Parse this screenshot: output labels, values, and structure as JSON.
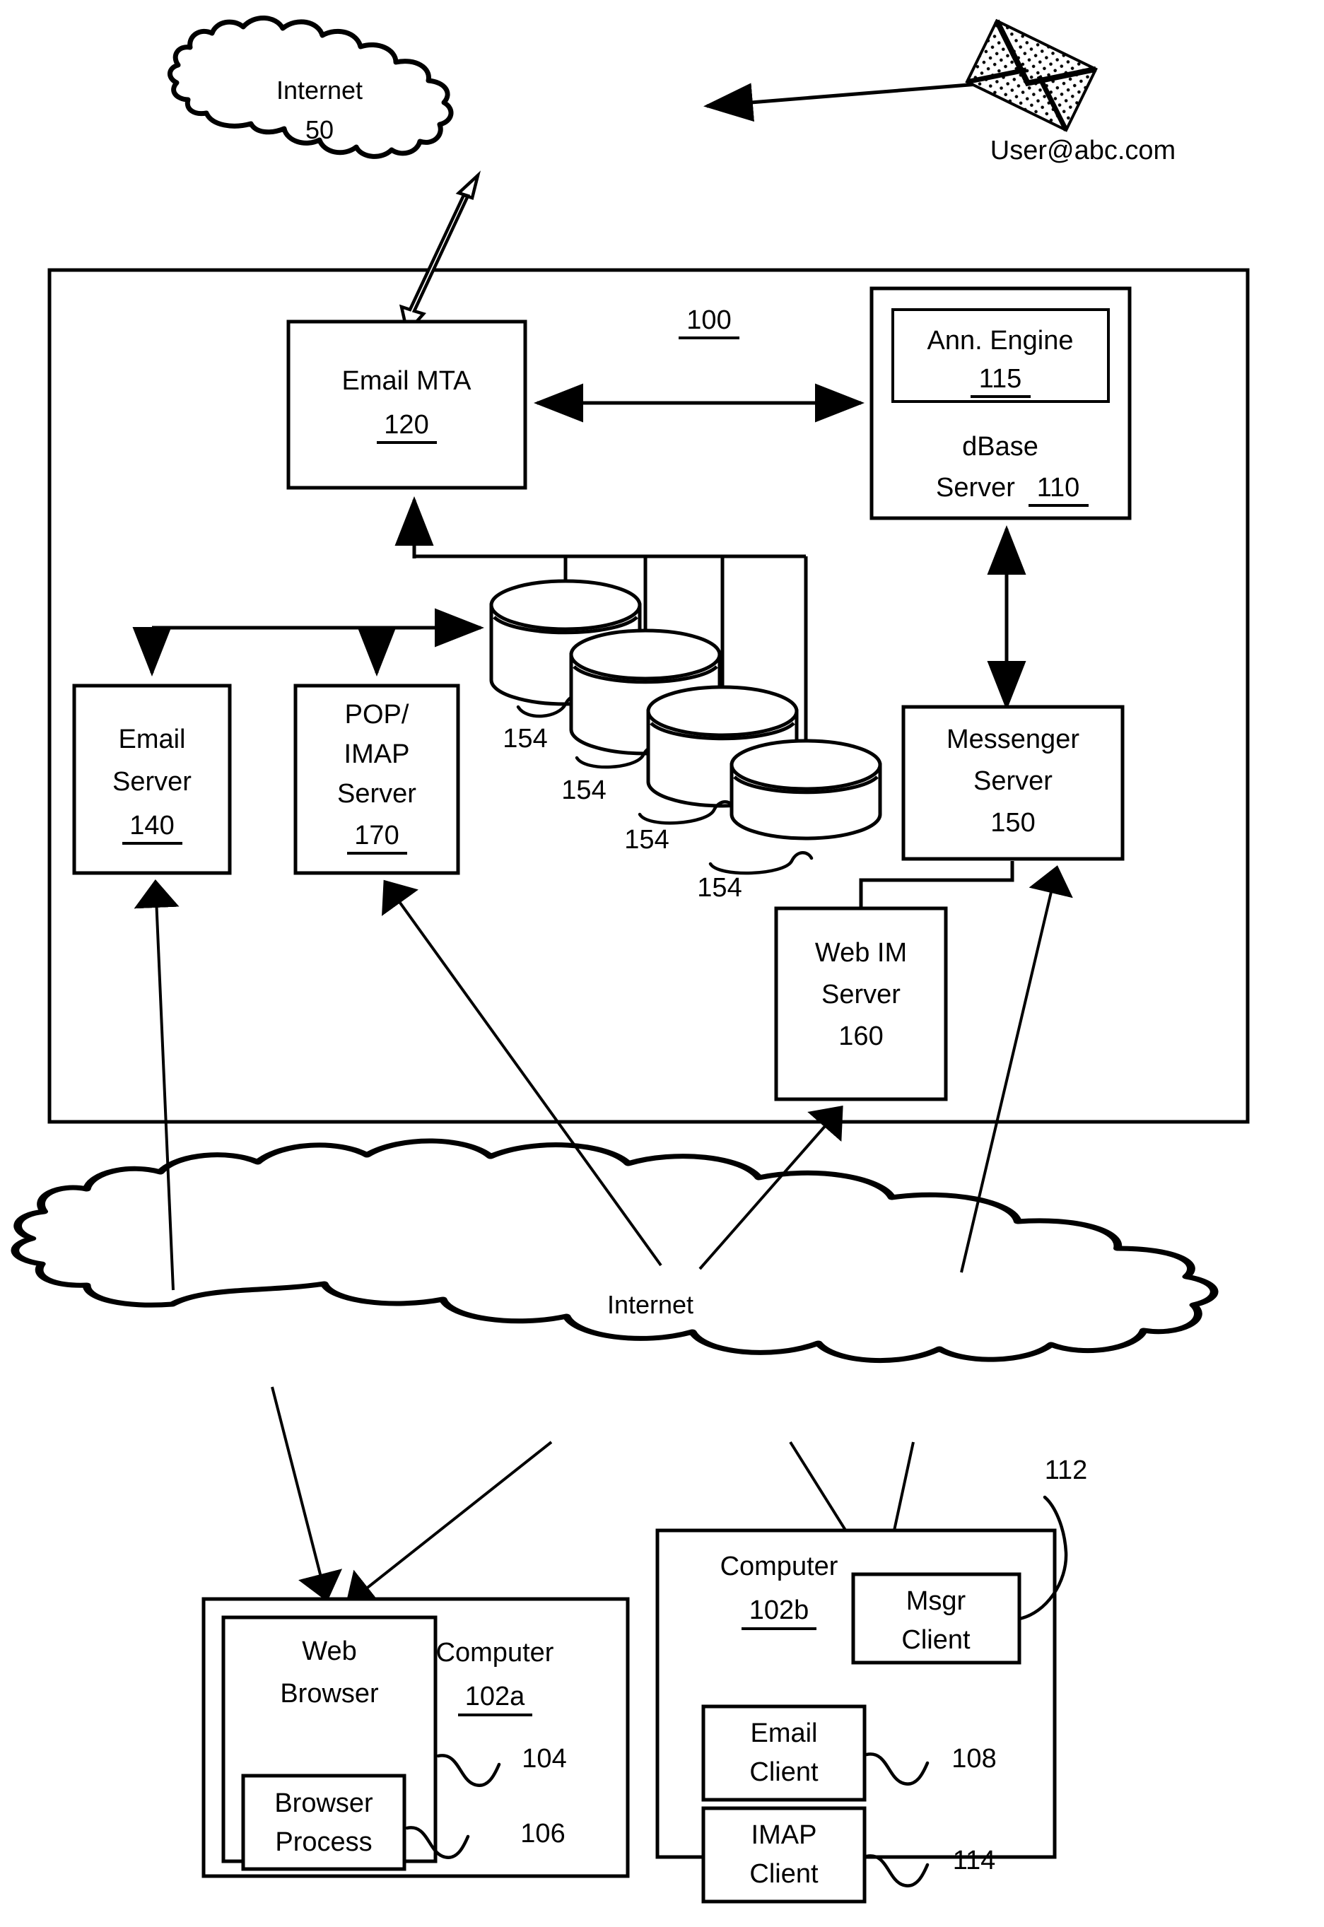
{
  "figure": {
    "system_ref": "100",
    "top_cloud": {
      "name": "Internet",
      "ref": "50"
    },
    "bottom_cloud": {
      "name": "Internet"
    },
    "external_user": {
      "address": "User@abc.com",
      "icon": "envelope-icon"
    },
    "nodes": {
      "email_mta": {
        "line1": "Email MTA",
        "ref": "120",
        "ref_underlined": true
      },
      "ann_engine": {
        "line1": "Ann. Engine",
        "ref": "115",
        "ref_underlined": true
      },
      "dbase_server": {
        "line1": "dBase",
        "line2": "Server",
        "ref": "110",
        "ref_underlined": true
      },
      "email_server": {
        "line1": "Email",
        "line2": "Server",
        "ref": "140",
        "ref_underlined": true
      },
      "pop_imap_server": {
        "line1": "POP/",
        "line2": "IMAP",
        "line3": "Server",
        "ref": "170",
        "ref_underlined": true
      },
      "messenger_server": {
        "line1": "Messenger",
        "line2": "Server",
        "ref": "150",
        "ref_underlined": false
      },
      "web_im_server": {
        "line1": "Web IM",
        "line2": "Server",
        "ref": "160",
        "ref_underlined": false
      }
    },
    "databases": [
      {
        "ref": "154"
      },
      {
        "ref": "154"
      },
      {
        "ref": "154"
      },
      {
        "ref": "154"
      }
    ],
    "computer_a": {
      "label": "Computer",
      "ref": "102a",
      "ref_underlined": true,
      "web_browser": {
        "line1": "Web",
        "line2": "Browser",
        "ref": "104"
      },
      "browser_process": {
        "line1": "Browser",
        "line2": "Process",
        "ref": "106"
      }
    },
    "computer_b": {
      "label": "Computer",
      "ref": "102b",
      "ref_underlined": true,
      "msgr_client": {
        "line1": "Msgr",
        "line2": "Client",
        "ref": "112"
      },
      "email_client": {
        "line1": "Email",
        "line2": "Client",
        "ref": "108"
      },
      "imap_client": {
        "line1": "IMAP",
        "line2": "Client",
        "ref": "114"
      }
    }
  }
}
